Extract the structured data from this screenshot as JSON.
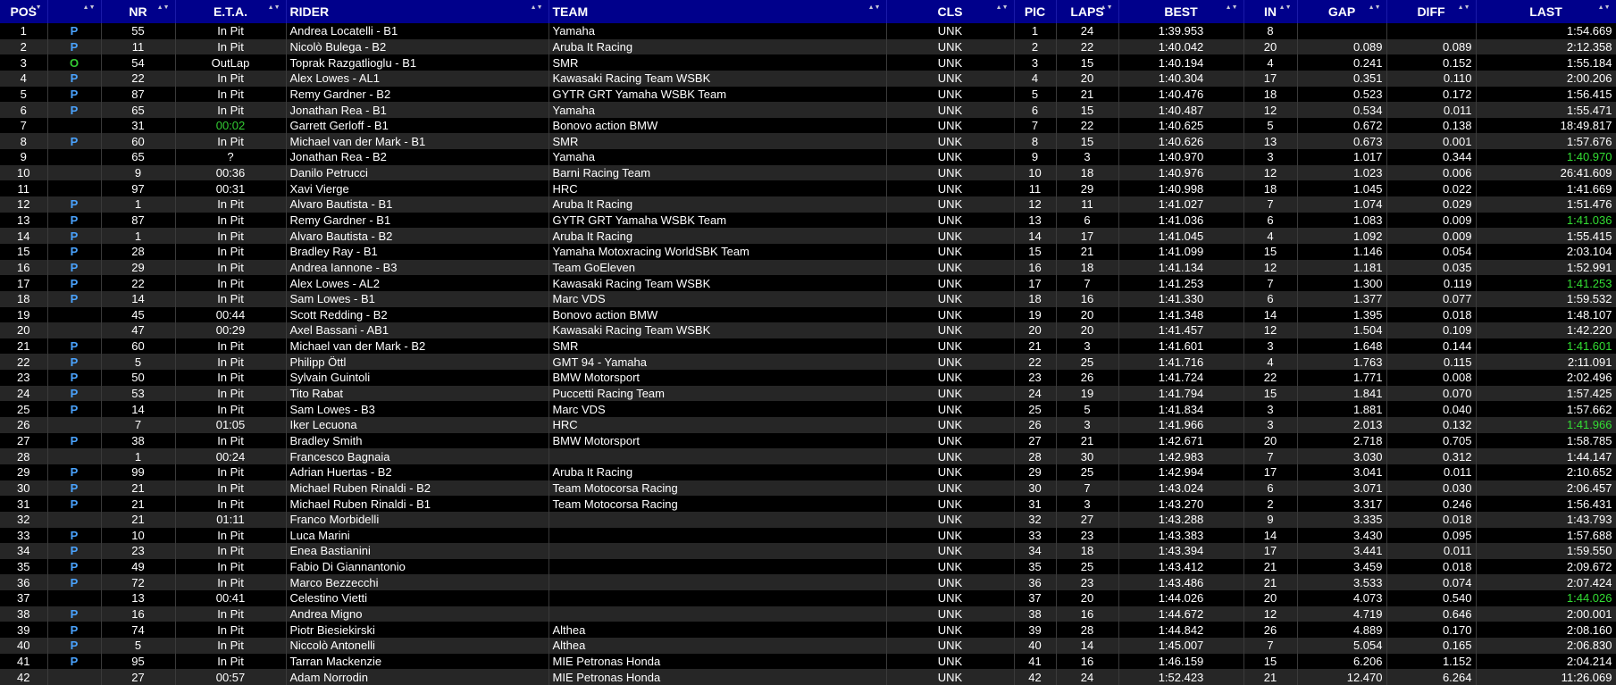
{
  "colors": {
    "header_bg": "#00008b",
    "pit_flag": "#4aa3ff",
    "outlap_flag": "#33cc33",
    "best_lap_green": "#33dd33"
  },
  "headers": {
    "pos": "POS",
    "status": "",
    "nr": "NR",
    "eta": "E.T.A.",
    "rider": "RIDER",
    "team": "TEAM",
    "cls": "CLS",
    "pic": "PIC",
    "laps": "LAPS",
    "best": "BEST",
    "in": "IN",
    "gap": "GAP",
    "diff": "DIFF",
    "last": "LAST"
  },
  "rows": [
    {
      "pos": "1",
      "st": "P",
      "nr": "55",
      "eta": "In Pit",
      "rider": "Andrea Locatelli - B1",
      "team": "Yamaha",
      "cls": "UNK",
      "pic": "1",
      "laps": "24",
      "best": "1:39.953",
      "in": "8",
      "gap": "",
      "diff": "",
      "last": "1:54.669"
    },
    {
      "pos": "2",
      "st": "P",
      "nr": "11",
      "eta": "In Pit",
      "rider": "Nicolò Bulega - B2",
      "team": "Aruba It Racing",
      "cls": "UNK",
      "pic": "2",
      "laps": "22",
      "best": "1:40.042",
      "in": "20",
      "gap": "0.089",
      "diff": "0.089",
      "last": "2:12.358"
    },
    {
      "pos": "3",
      "st": "O",
      "nr": "54",
      "eta": "OutLap",
      "rider": "Toprak Razgatlioglu - B1",
      "team": "SMR",
      "cls": "UNK",
      "pic": "3",
      "laps": "15",
      "best": "1:40.194",
      "in": "4",
      "gap": "0.241",
      "diff": "0.152",
      "last": "1:55.184"
    },
    {
      "pos": "4",
      "st": "P",
      "nr": "22",
      "eta": "In Pit",
      "rider": "Alex Lowes - AL1",
      "team": "Kawasaki Racing Team WSBK",
      "cls": "UNK",
      "pic": "4",
      "laps": "20",
      "best": "1:40.304",
      "in": "17",
      "gap": "0.351",
      "diff": "0.110",
      "last": "2:00.206"
    },
    {
      "pos": "5",
      "st": "P",
      "nr": "87",
      "eta": "In Pit",
      "rider": "Remy Gardner - B2",
      "team": "GYTR GRT Yamaha WSBK Team",
      "cls": "UNK",
      "pic": "5",
      "laps": "21",
      "best": "1:40.476",
      "in": "18",
      "gap": "0.523",
      "diff": "0.172",
      "last": "1:56.415"
    },
    {
      "pos": "6",
      "st": "P",
      "nr": "65",
      "eta": "In Pit",
      "rider": "Jonathan Rea - B1",
      "team": "Yamaha",
      "cls": "UNK",
      "pic": "6",
      "laps": "15",
      "best": "1:40.487",
      "in": "12",
      "gap": "0.534",
      "diff": "0.011",
      "last": "1:55.471"
    },
    {
      "pos": "7",
      "st": "",
      "nr": "31",
      "eta": "00:02",
      "eta_green": true,
      "rider": "Garrett Gerloff - B1",
      "team": "Bonovo action BMW",
      "cls": "UNK",
      "pic": "7",
      "laps": "22",
      "best": "1:40.625",
      "in": "5",
      "gap": "0.672",
      "diff": "0.138",
      "last": "18:49.817"
    },
    {
      "pos": "8",
      "st": "P",
      "nr": "60",
      "eta": "In Pit",
      "rider": "Michael van der Mark - B1",
      "team": "SMR",
      "cls": "UNK",
      "pic": "8",
      "laps": "15",
      "best": "1:40.626",
      "in": "13",
      "gap": "0.673",
      "diff": "0.001",
      "last": "1:57.676"
    },
    {
      "pos": "9",
      "st": "",
      "nr": "65",
      "eta": "?",
      "rider": "Jonathan Rea - B2",
      "team": "Yamaha",
      "cls": "UNK",
      "pic": "9",
      "laps": "3",
      "best": "1:40.970",
      "in": "3",
      "gap": "1.017",
      "diff": "0.344",
      "last": "1:40.970",
      "last_green": true
    },
    {
      "pos": "10",
      "st": "",
      "nr": "9",
      "eta": "00:36",
      "rider": "Danilo Petrucci",
      "team": "Barni Racing Team",
      "cls": "UNK",
      "pic": "10",
      "laps": "18",
      "best": "1:40.976",
      "in": "12",
      "gap": "1.023",
      "diff": "0.006",
      "last": "26:41.609"
    },
    {
      "pos": "11",
      "st": "",
      "nr": "97",
      "eta": "00:31",
      "rider": "Xavi Vierge",
      "team": "HRC",
      "cls": "UNK",
      "pic": "11",
      "laps": "29",
      "best": "1:40.998",
      "in": "18",
      "gap": "1.045",
      "diff": "0.022",
      "last": "1:41.669"
    },
    {
      "pos": "12",
      "st": "P",
      "nr": "1",
      "eta": "In Pit",
      "rider": "Alvaro Bautista - B1",
      "team": "Aruba It Racing",
      "cls": "UNK",
      "pic": "12",
      "laps": "11",
      "best": "1:41.027",
      "in": "7",
      "gap": "1.074",
      "diff": "0.029",
      "last": "1:51.476"
    },
    {
      "pos": "13",
      "st": "P",
      "nr": "87",
      "eta": "In Pit",
      "rider": "Remy Gardner - B1",
      "team": "GYTR GRT Yamaha WSBK Team",
      "cls": "UNK",
      "pic": "13",
      "laps": "6",
      "best": "1:41.036",
      "in": "6",
      "gap": "1.083",
      "diff": "0.009",
      "last": "1:41.036",
      "last_green": true
    },
    {
      "pos": "14",
      "st": "P",
      "nr": "1",
      "eta": "In Pit",
      "rider": "Alvaro Bautista - B2",
      "team": "Aruba It Racing",
      "cls": "UNK",
      "pic": "14",
      "laps": "17",
      "best": "1:41.045",
      "in": "4",
      "gap": "1.092",
      "diff": "0.009",
      "last": "1:55.415"
    },
    {
      "pos": "15",
      "st": "P",
      "nr": "28",
      "eta": "In Pit",
      "rider": "Bradley Ray - B1",
      "team": "Yamaha Motoxracing WorldSBK Team",
      "cls": "UNK",
      "pic": "15",
      "laps": "21",
      "best": "1:41.099",
      "in": "15",
      "gap": "1.146",
      "diff": "0.054",
      "last": "2:03.104"
    },
    {
      "pos": "16",
      "st": "P",
      "nr": "29",
      "eta": "In Pit",
      "rider": "Andrea Iannone - B3",
      "team": "Team GoEleven",
      "cls": "UNK",
      "pic": "16",
      "laps": "18",
      "best": "1:41.134",
      "in": "12",
      "gap": "1.181",
      "diff": "0.035",
      "last": "1:52.991"
    },
    {
      "pos": "17",
      "st": "P",
      "nr": "22",
      "eta": "In Pit",
      "rider": "Alex Lowes - AL2",
      "team": "Kawasaki Racing Team WSBK",
      "cls": "UNK",
      "pic": "17",
      "laps": "7",
      "best": "1:41.253",
      "in": "7",
      "gap": "1.300",
      "diff": "0.119",
      "last": "1:41.253",
      "last_green": true
    },
    {
      "pos": "18",
      "st": "P",
      "nr": "14",
      "eta": "In Pit",
      "rider": "Sam Lowes - B1",
      "team": "Marc VDS",
      "cls": "UNK",
      "pic": "18",
      "laps": "16",
      "best": "1:41.330",
      "in": "6",
      "gap": "1.377",
      "diff": "0.077",
      "last": "1:59.532"
    },
    {
      "pos": "19",
      "st": "",
      "nr": "45",
      "eta": "00:44",
      "rider": "Scott Redding - B2",
      "team": "Bonovo action BMW",
      "cls": "UNK",
      "pic": "19",
      "laps": "20",
      "best": "1:41.348",
      "in": "14",
      "gap": "1.395",
      "diff": "0.018",
      "last": "1:48.107"
    },
    {
      "pos": "20",
      "st": "",
      "nr": "47",
      "eta": "00:29",
      "rider": "Axel Bassani - AB1",
      "team": "Kawasaki Racing Team WSBK",
      "cls": "UNK",
      "pic": "20",
      "laps": "20",
      "best": "1:41.457",
      "in": "12",
      "gap": "1.504",
      "diff": "0.109",
      "last": "1:42.220"
    },
    {
      "pos": "21",
      "st": "P",
      "nr": "60",
      "eta": "In Pit",
      "rider": "Michael van der Mark - B2",
      "team": "SMR",
      "cls": "UNK",
      "pic": "21",
      "laps": "3",
      "best": "1:41.601",
      "in": "3",
      "gap": "1.648",
      "diff": "0.144",
      "last": "1:41.601",
      "last_green": true
    },
    {
      "pos": "22",
      "st": "P",
      "nr": "5",
      "eta": "In Pit",
      "rider": "Philipp Öttl",
      "team": "GMT 94 - Yamaha",
      "cls": "UNK",
      "pic": "22",
      "laps": "25",
      "best": "1:41.716",
      "in": "4",
      "gap": "1.763",
      "diff": "0.115",
      "last": "2:11.091"
    },
    {
      "pos": "23",
      "st": "P",
      "nr": "50",
      "eta": "In Pit",
      "rider": "Sylvain Guintoli",
      "team": "BMW Motorsport",
      "cls": "UNK",
      "pic": "23",
      "laps": "26",
      "best": "1:41.724",
      "in": "22",
      "gap": "1.771",
      "diff": "0.008",
      "last": "2:02.496"
    },
    {
      "pos": "24",
      "st": "P",
      "nr": "53",
      "eta": "In Pit",
      "rider": "Tito Rabat",
      "team": "Puccetti Racing Team",
      "cls": "UNK",
      "pic": "24",
      "laps": "19",
      "best": "1:41.794",
      "in": "15",
      "gap": "1.841",
      "diff": "0.070",
      "last": "1:57.425"
    },
    {
      "pos": "25",
      "st": "P",
      "nr": "14",
      "eta": "In Pit",
      "rider": "Sam Lowes - B3",
      "team": "Marc VDS",
      "cls": "UNK",
      "pic": "25",
      "laps": "5",
      "best": "1:41.834",
      "in": "3",
      "gap": "1.881",
      "diff": "0.040",
      "last": "1:57.662"
    },
    {
      "pos": "26",
      "st": "",
      "nr": "7",
      "eta": "01:05",
      "rider": "Iker Lecuona",
      "team": "HRC",
      "cls": "UNK",
      "pic": "26",
      "laps": "3",
      "best": "1:41.966",
      "in": "3",
      "gap": "2.013",
      "diff": "0.132",
      "last": "1:41.966",
      "last_green": true
    },
    {
      "pos": "27",
      "st": "P",
      "nr": "38",
      "eta": "In Pit",
      "rider": "Bradley Smith",
      "team": "BMW Motorsport",
      "cls": "UNK",
      "pic": "27",
      "laps": "21",
      "best": "1:42.671",
      "in": "20",
      "gap": "2.718",
      "diff": "0.705",
      "last": "1:58.785"
    },
    {
      "pos": "28",
      "st": "",
      "nr": "1",
      "eta": "00:24",
      "rider": "Francesco Bagnaia",
      "team": "",
      "cls": "UNK",
      "pic": "28",
      "laps": "30",
      "best": "1:42.983",
      "in": "7",
      "gap": "3.030",
      "diff": "0.312",
      "last": "1:44.147"
    },
    {
      "pos": "29",
      "st": "P",
      "nr": "99",
      "eta": "In Pit",
      "rider": "Adrian Huertas - B2",
      "team": "Aruba It Racing",
      "cls": "UNK",
      "pic": "29",
      "laps": "25",
      "best": "1:42.994",
      "in": "17",
      "gap": "3.041",
      "diff": "0.011",
      "last": "2:10.652"
    },
    {
      "pos": "30",
      "st": "P",
      "nr": "21",
      "eta": "In Pit",
      "rider": "Michael Ruben Rinaldi - B2",
      "team": "Team Motocorsa Racing",
      "cls": "UNK",
      "pic": "30",
      "laps": "7",
      "best": "1:43.024",
      "in": "6",
      "gap": "3.071",
      "diff": "0.030",
      "last": "2:06.457"
    },
    {
      "pos": "31",
      "st": "P",
      "nr": "21",
      "eta": "In Pit",
      "rider": "Michael Ruben Rinaldi - B1",
      "team": "Team Motocorsa Racing",
      "cls": "UNK",
      "pic": "31",
      "laps": "3",
      "best": "1:43.270",
      "in": "2",
      "gap": "3.317",
      "diff": "0.246",
      "last": "1:56.431"
    },
    {
      "pos": "32",
      "st": "",
      "nr": "21",
      "eta": "01:11",
      "rider": "Franco Morbidelli",
      "team": "",
      "cls": "UNK",
      "pic": "32",
      "laps": "27",
      "best": "1:43.288",
      "in": "9",
      "gap": "3.335",
      "diff": "0.018",
      "last": "1:43.793"
    },
    {
      "pos": "33",
      "st": "P",
      "nr": "10",
      "eta": "In Pit",
      "rider": "Luca Marini",
      "team": "",
      "cls": "UNK",
      "pic": "33",
      "laps": "23",
      "best": "1:43.383",
      "in": "14",
      "gap": "3.430",
      "diff": "0.095",
      "last": "1:57.688"
    },
    {
      "pos": "34",
      "st": "P",
      "nr": "23",
      "eta": "In Pit",
      "rider": "Enea Bastianini",
      "team": "",
      "cls": "UNK",
      "pic": "34",
      "laps": "18",
      "best": "1:43.394",
      "in": "17",
      "gap": "3.441",
      "diff": "0.011",
      "last": "1:59.550"
    },
    {
      "pos": "35",
      "st": "P",
      "nr": "49",
      "eta": "In Pit",
      "rider": "Fabio Di Giannantonio",
      "team": "",
      "cls": "UNK",
      "pic": "35",
      "laps": "25",
      "best": "1:43.412",
      "in": "21",
      "gap": "3.459",
      "diff": "0.018",
      "last": "2:09.672"
    },
    {
      "pos": "36",
      "st": "P",
      "nr": "72",
      "eta": "In Pit",
      "rider": "Marco Bezzecchi",
      "team": "",
      "cls": "UNK",
      "pic": "36",
      "laps": "23",
      "best": "1:43.486",
      "in": "21",
      "gap": "3.533",
      "diff": "0.074",
      "last": "2:07.424"
    },
    {
      "pos": "37",
      "st": "",
      "nr": "13",
      "eta": "00:41",
      "rider": "Celestino Vietti",
      "team": "",
      "cls": "UNK",
      "pic": "37",
      "laps": "20",
      "best": "1:44.026",
      "in": "20",
      "gap": "4.073",
      "diff": "0.540",
      "last": "1:44.026",
      "last_green": true
    },
    {
      "pos": "38",
      "st": "P",
      "nr": "16",
      "eta": "In Pit",
      "rider": "Andrea Migno",
      "team": "",
      "cls": "UNK",
      "pic": "38",
      "laps": "16",
      "best": "1:44.672",
      "in": "12",
      "gap": "4.719",
      "diff": "0.646",
      "last": "2:00.001"
    },
    {
      "pos": "39",
      "st": "P",
      "nr": "74",
      "eta": "In Pit",
      "rider": "Piotr Biesiekirski",
      "team": "Althea",
      "cls": "UNK",
      "pic": "39",
      "laps": "28",
      "best": "1:44.842",
      "in": "26",
      "gap": "4.889",
      "diff": "0.170",
      "last": "2:08.160"
    },
    {
      "pos": "40",
      "st": "P",
      "nr": "5",
      "eta": "In Pit",
      "rider": "Niccolò Antonelli",
      "team": "Althea",
      "cls": "UNK",
      "pic": "40",
      "laps": "14",
      "best": "1:45.007",
      "in": "7",
      "gap": "5.054",
      "diff": "0.165",
      "last": "2:06.830"
    },
    {
      "pos": "41",
      "st": "P",
      "nr": "95",
      "eta": "In Pit",
      "rider": "Tarran Mackenzie",
      "team": "MIE Petronas Honda",
      "cls": "UNK",
      "pic": "41",
      "laps": "16",
      "best": "1:46.159",
      "in": "15",
      "gap": "6.206",
      "diff": "1.152",
      "last": "2:04.214"
    },
    {
      "pos": "42",
      "st": "",
      "nr": "27",
      "eta": "00:57",
      "rider": "Adam Norrodin",
      "team": "MIE Petronas Honda",
      "cls": "UNK",
      "pic": "42",
      "laps": "24",
      "best": "1:52.423",
      "in": "21",
      "gap": "12.470",
      "diff": "6.264",
      "last": "11:26.069"
    }
  ]
}
